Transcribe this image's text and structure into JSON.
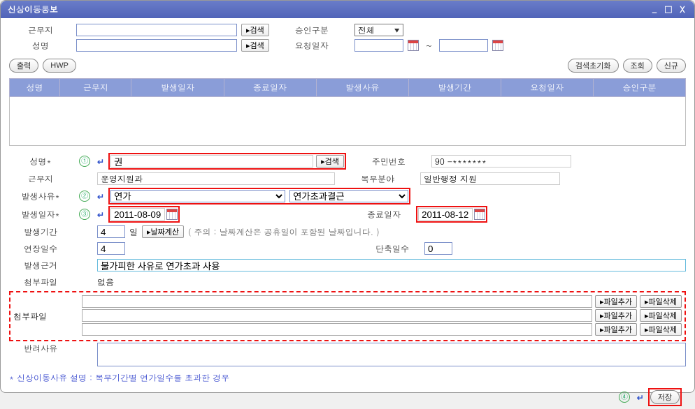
{
  "window": {
    "title": "신상이동통보",
    "min": "_",
    "max": "□",
    "close": "X"
  },
  "search": {
    "workplace_label": "근무지",
    "name_label": "성명",
    "search_btn": "▸검색",
    "approval_type_label": "승인구분",
    "approval_type_value": "전체",
    "request_date_label": "요청일자",
    "tilde": "~"
  },
  "toolbar": {
    "print": "출력",
    "hwp": "HWP",
    "reset": "검색초기화",
    "query": "조회",
    "new": "신규"
  },
  "grid_headers": [
    "성명",
    "근무지",
    "발생일자",
    "종료일자",
    "발생사유",
    "발생기간",
    "요청일자",
    "승인구분"
  ],
  "circled": {
    "c1": "①",
    "c2": "②",
    "c3": "③",
    "c4": "④"
  },
  "form": {
    "name_label": "성명*",
    "name_value": "권",
    "name_search": "▸검색",
    "rrn_label": "주민번호",
    "rrn_value": "90      -*******",
    "workplace_label": "근무지",
    "workplace_value": "운영지원과",
    "service_field_label": "복무분야",
    "service_field_value": "일반행정 지원",
    "reason_label": "발생사유*",
    "reason_value": "연가",
    "reason2_value": "연가초과결근",
    "start_date_label": "발생일자*",
    "start_date_value": "2011-08-09",
    "end_date_label": "종료일자",
    "end_date_value": "2011-08-12",
    "period_label": "발생기간",
    "period_value": "4",
    "period_unit": "일",
    "date_calc_btn": "▸날짜계산",
    "period_note": "( 주의 : 날짜계산은 공휴일이 포함된 날짜입니다. )",
    "extend_label": "연장일수",
    "extend_value": "4",
    "short_label": "단축일수",
    "short_value": "0",
    "basis_label": "발생근거",
    "basis_value": "불가피한 사유로 연가초과 사용",
    "attach_label": "첨부파일",
    "attach_value": "없음",
    "attach2_label": "첨부파일",
    "attach_add": "▸파일추가",
    "attach_del": "▸파일삭제",
    "reject_label": "반려사유"
  },
  "footer_note": "* 신상이동사유 설명 : 복무기간별 연가일수를 초과한 경우",
  "save_btn": "저장"
}
